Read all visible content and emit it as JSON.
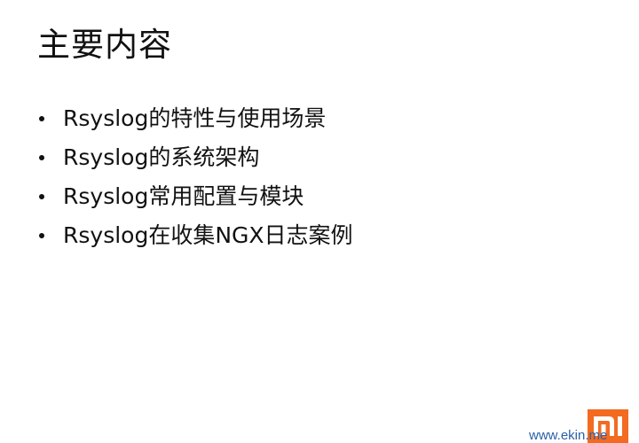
{
  "slide": {
    "title": "主要内容",
    "bullets": [
      "Rsyslog的特性与使用场景",
      "Rsyslog的系统架构",
      "Rsyslog常用配置与模块",
      "Rsyslog在收集NGX日志案例"
    ]
  },
  "branding": {
    "logo_icon": "mi-logo-icon",
    "logo_color": "#f26b21",
    "footer_text": "www.ekin.me"
  }
}
